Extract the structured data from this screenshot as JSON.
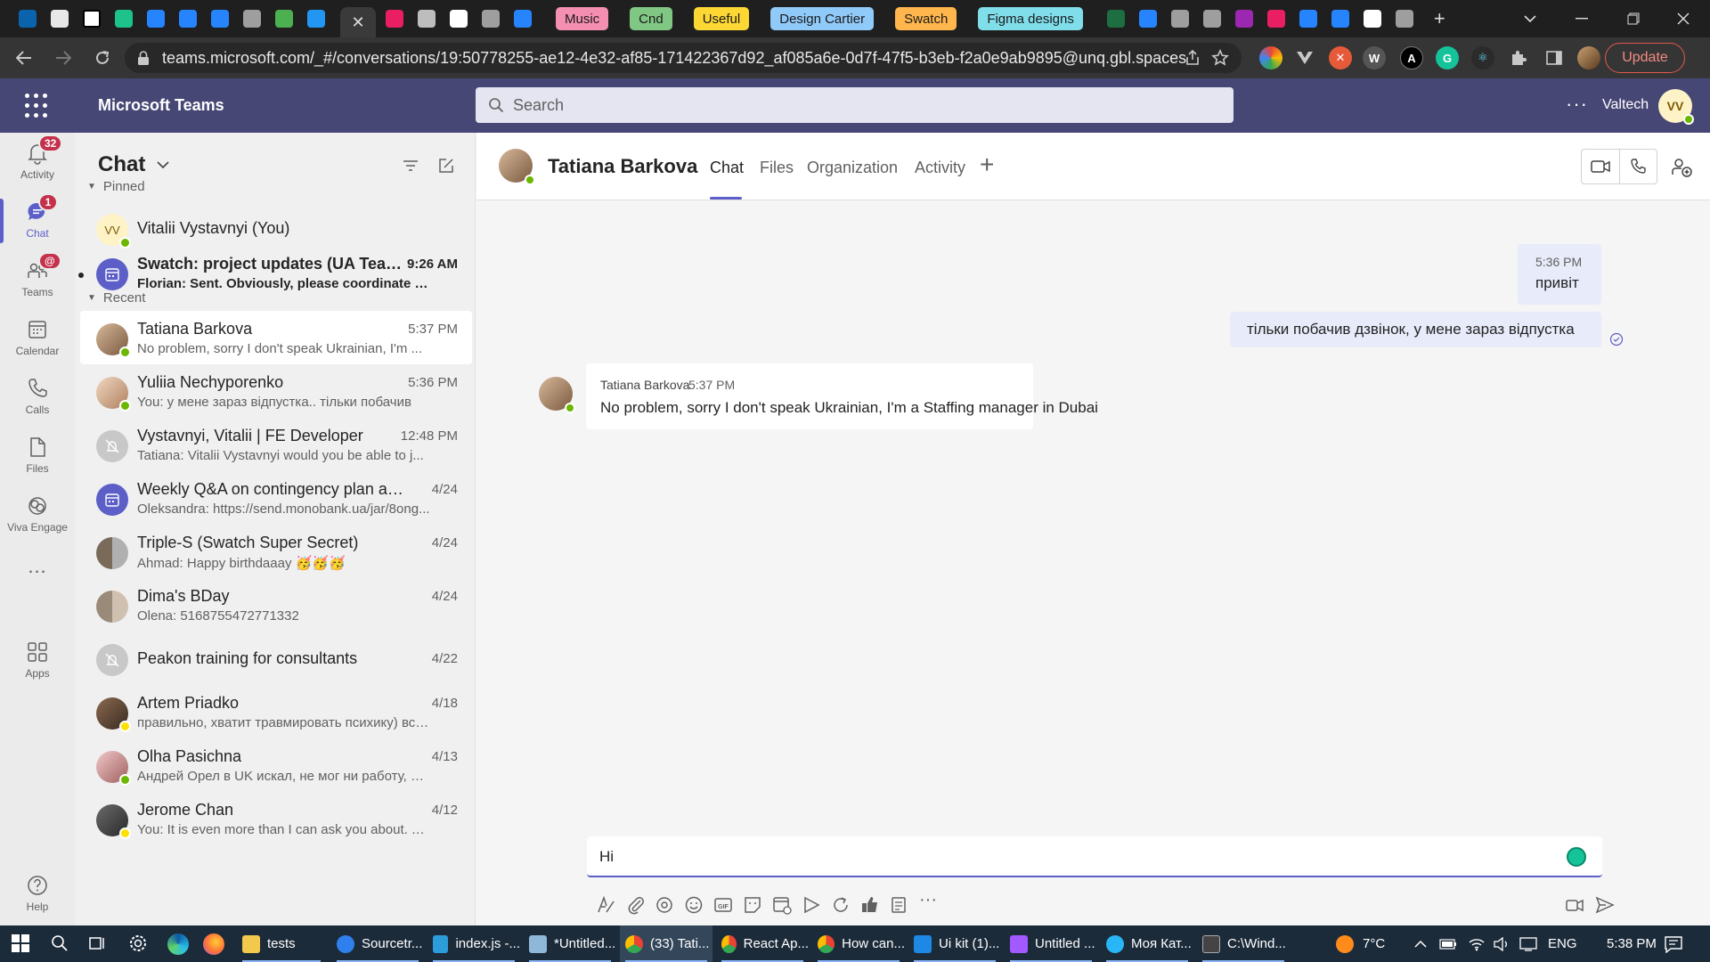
{
  "browser": {
    "bookmarks": [
      {
        "label": "Music",
        "bg": "#f48fb1"
      },
      {
        "label": "Cnd",
        "bg": "#81c784"
      },
      {
        "label": "Useful",
        "bg": "#fdd835"
      },
      {
        "label": "Design Cartier",
        "bg": "#90caf9"
      },
      {
        "label": "Swatch",
        "bg": "#ffb74d"
      },
      {
        "label": "Figma designs",
        "bg": "#80deea"
      }
    ],
    "active_tab_close": "✕",
    "new_tab": "+",
    "url": "teams.microsoft.com/_#/conversations/19:50778255-ae12-4e32-af85-171422367d92_af085a6e-0d7f-47f5-b3eb-f2a0e9ab9895@unq.gbl.spaces?c...",
    "update_label": "Update"
  },
  "teams": {
    "app_name": "Microsoft Teams",
    "search_placeholder": "Search",
    "org": "Valtech",
    "me_initials": "VV",
    "accent": "#5b5fc7",
    "header_bg": "#464775"
  },
  "rail": [
    {
      "label": "Activity",
      "icon": "bell-icon",
      "badge": "32"
    },
    {
      "label": "Chat",
      "icon": "chat-icon",
      "badge": "1"
    },
    {
      "label": "Teams",
      "icon": "teams-icon",
      "badge": "@"
    },
    {
      "label": "Calendar",
      "icon": "calendar-icon",
      "badge": ""
    },
    {
      "label": "Calls",
      "icon": "phone-icon",
      "badge": ""
    },
    {
      "label": "Files",
      "icon": "file-icon",
      "badge": ""
    },
    {
      "label": "Viva Engage",
      "icon": "viva-icon",
      "badge": ""
    },
    {
      "label": "...",
      "icon": "more-icon",
      "badge": ""
    },
    {
      "label": "Apps",
      "icon": "apps-icon",
      "badge": ""
    },
    {
      "label": "Help",
      "icon": "help-icon",
      "badge": ""
    }
  ],
  "chatlist": {
    "title": "Chat",
    "pinned_label": "Pinned",
    "recent_label": "Recent",
    "pinned": [
      {
        "name": "Vitalii Vystavnyi (You)",
        "preview": "",
        "time": "",
        "initials": "VV",
        "avatar_bg": "#fef3c7"
      },
      {
        "name": "Swatch: project updates (UA Team)",
        "preview": "Florian: Sent. Obviously, please coordinate be...",
        "time": "9:26 AM",
        "initials": "",
        "avatar_bg": "#5b5fc7",
        "unread": true
      }
    ],
    "recent": [
      {
        "name": "Tatiana Barkova",
        "preview": "No problem, sorry I don't speak Ukrainian, I'm ...",
        "time": "5:37 PM",
        "avatar_bg": "#a57c5b"
      },
      {
        "name": "Yuliia Nechyporenko",
        "preview": "You: у мене зараз відпустка.. тільки побачив",
        "time": "5:36 PM",
        "avatar_bg": "#c9a58a"
      },
      {
        "name": "Vystavnyi, Vitalii | FE Developer",
        "preview": "Tatiana: Vitalii Vystavnyi would you be able to j...",
        "time": "12:48 PM",
        "avatar_bg": "#c8c8c8"
      },
      {
        "name": "Weekly Q&A on contingency plan and ...",
        "preview": "Oleksandra: https://send.monobank.ua/jar/8ong...",
        "time": "4/24",
        "avatar_bg": "#5b5fc7"
      },
      {
        "name": "Triple-S (Swatch Super Secret)",
        "preview": "Ahmad: Happy birthdaaay 🥳🥳🥳",
        "time": "4/24",
        "avatar_bg": "#8a8a8a"
      },
      {
        "name": "Dima's BDay",
        "preview": "Olena: 5168755472771332",
        "time": "4/24",
        "avatar_bg": "#9a8a7a"
      },
      {
        "name": "Peakon training for consultants",
        "preview": "",
        "time": "4/22",
        "avatar_bg": "#c8c8c8"
      },
      {
        "name": "Artem Priadko",
        "preview": "правильно, хватит травмировать психику) все...",
        "time": "4/18",
        "avatar_bg": "#6a5040"
      },
      {
        "name": "Olha Pasichna",
        "preview": "Андрей Орел в UK искал, не мог ни работу, ни...",
        "time": "4/13",
        "avatar_bg": "#d2a0a0"
      },
      {
        "name": "Jerome Chan",
        "preview": "You: It is even more than I can ask you about. Th...",
        "time": "4/12",
        "avatar_bg": "#4a4a4a"
      }
    ]
  },
  "conversation": {
    "name": "Tatiana Barkova",
    "tabs": [
      "Chat",
      "Files",
      "Organization",
      "Activity"
    ],
    "messages": {
      "sent1_time": "5:36 PM",
      "sent1_text": "привіт",
      "sent2_text": "тільки побачив дзвінок, у мене зараз відпустка",
      "recv_name": "Tatiana Barkova",
      "recv_time": "5:37 PM",
      "recv_text": "No problem, sorry I don't speak Ukrainian, I'm a Staffing manager in Dubai"
    },
    "compose_value": "Hi"
  },
  "taskbar": {
    "apps": [
      {
        "label": "tests",
        "color": "#f2c94c"
      },
      {
        "label": "Sourcetr...",
        "color": "#2f80ed"
      },
      {
        "label": "index.js -...",
        "color": "#2d9cdb"
      },
      {
        "label": "*Untitled...",
        "color": "#8fb8d8"
      },
      {
        "label": "(33) Tati...",
        "color": "#ea4335"
      },
      {
        "label": "React Ap...",
        "color": "#ea4335"
      },
      {
        "label": "How can...",
        "color": "#ea4335"
      },
      {
        "label": "Ui kit (1)...",
        "color": "#1e88e5"
      },
      {
        "label": "Untitled ...",
        "color": "#a259ff"
      },
      {
        "label": "Моя Кат...",
        "color": "#29b6f6"
      },
      {
        "label": "C:\\Wind...",
        "color": "#444444"
      }
    ],
    "weather": "7°C",
    "lang": "ENG",
    "time": "5:38 PM"
  }
}
